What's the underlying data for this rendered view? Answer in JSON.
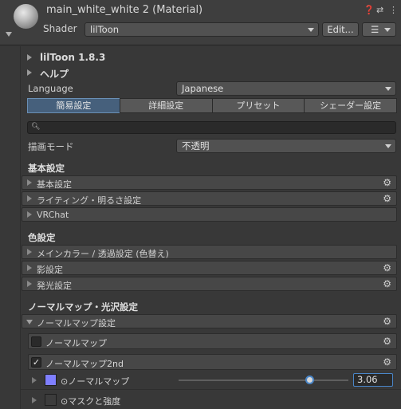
{
  "header": {
    "title": "main_white_white 2 (Material)",
    "shader_label": "Shader",
    "shader_value": "lilToon",
    "edit_button": "Edit...",
    "menu_icon": "list-menu-icon",
    "help_icon": "help-icon",
    "settings_icon": "sliders-icon",
    "more_icon": "kebab-icon"
  },
  "foldouts": {
    "version": "lilToon 1.8.3",
    "help": "ヘルプ"
  },
  "language": {
    "label": "Language",
    "value": "Japanese"
  },
  "tabs": [
    {
      "label": "簡易設定",
      "active": true
    },
    {
      "label": "詳細設定",
      "active": false
    },
    {
      "label": "プリセット",
      "active": false
    },
    {
      "label": "シェーダー設定",
      "active": false
    }
  ],
  "search": {
    "placeholder": "",
    "icon": "search-icon"
  },
  "render_mode": {
    "label": "描画モード",
    "value": "不透明"
  },
  "sections": {
    "basic": {
      "title": "基本設定",
      "items": [
        {
          "label": "基本設定",
          "has_gear": true
        },
        {
          "label": "ライティング・明るさ設定",
          "has_gear": true
        },
        {
          "label": "VRChat",
          "has_gear": false
        }
      ]
    },
    "color": {
      "title": "色設定",
      "items": [
        {
          "label": "メインカラー / 透過設定 (色替え)",
          "has_gear": false
        },
        {
          "label": "影設定",
          "has_gear": true
        },
        {
          "label": "発光設定",
          "has_gear": true
        }
      ]
    },
    "normal": {
      "title": "ノーマルマップ・光沢設定",
      "group_label": "ノーマルマップ設定",
      "normal_map": {
        "label": "ノーマルマップ",
        "checked": false
      },
      "normal_map_2nd": {
        "label": "ノーマルマップ2nd",
        "checked": true
      },
      "props": [
        {
          "label": "⊙ノーマルマップ",
          "swatch": "#7f7fff",
          "value": "3.06",
          "slider_fraction": 0.77
        },
        {
          "label": "⊙マスクと強度",
          "swatch": "#3c3c3c"
        }
      ]
    }
  },
  "colors": {
    "accent": "#4a86c8",
    "tab_active": "#46607c",
    "normal_swatch": "#7f7fff"
  }
}
